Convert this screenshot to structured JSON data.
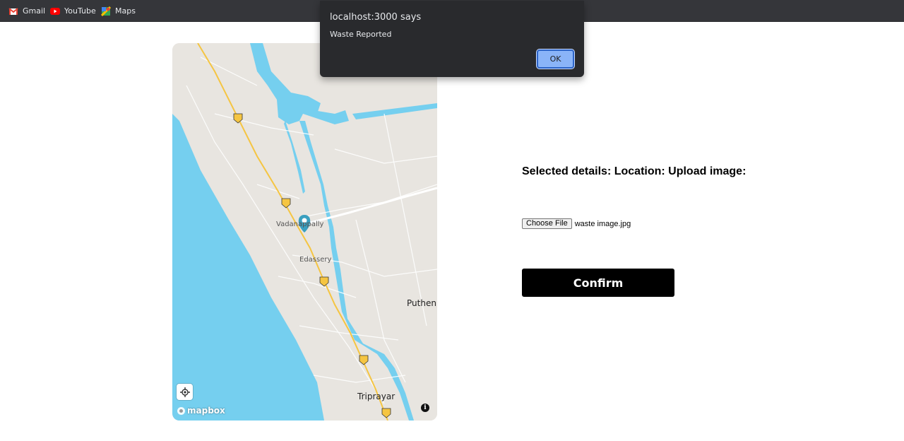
{
  "bookmarks": [
    {
      "label": "Gmail",
      "icon": "gmail-icon"
    },
    {
      "label": "YouTube",
      "icon": "youtube-icon"
    },
    {
      "label": "Maps",
      "icon": "maps-icon"
    }
  ],
  "dialog": {
    "title": "localhost:3000 says",
    "message": "Waste Reported",
    "ok_label": "OK"
  },
  "map": {
    "places": [
      "Vadanappally",
      "Edassery",
      "Puthenp",
      "Triprayar"
    ],
    "highway_shield": "66",
    "attribution_logo": "mapbox",
    "info_label": "i",
    "colors": {
      "land": "#e8e5e0",
      "water": "#75cfef",
      "highway": "#f5c542",
      "marker": "#3a9fbf"
    }
  },
  "form": {
    "details_label": "Selected details: Location: Upload image:",
    "choose_file_label": "Choose File",
    "file_name": "waste image.jpg",
    "confirm_label": "Confirm"
  }
}
